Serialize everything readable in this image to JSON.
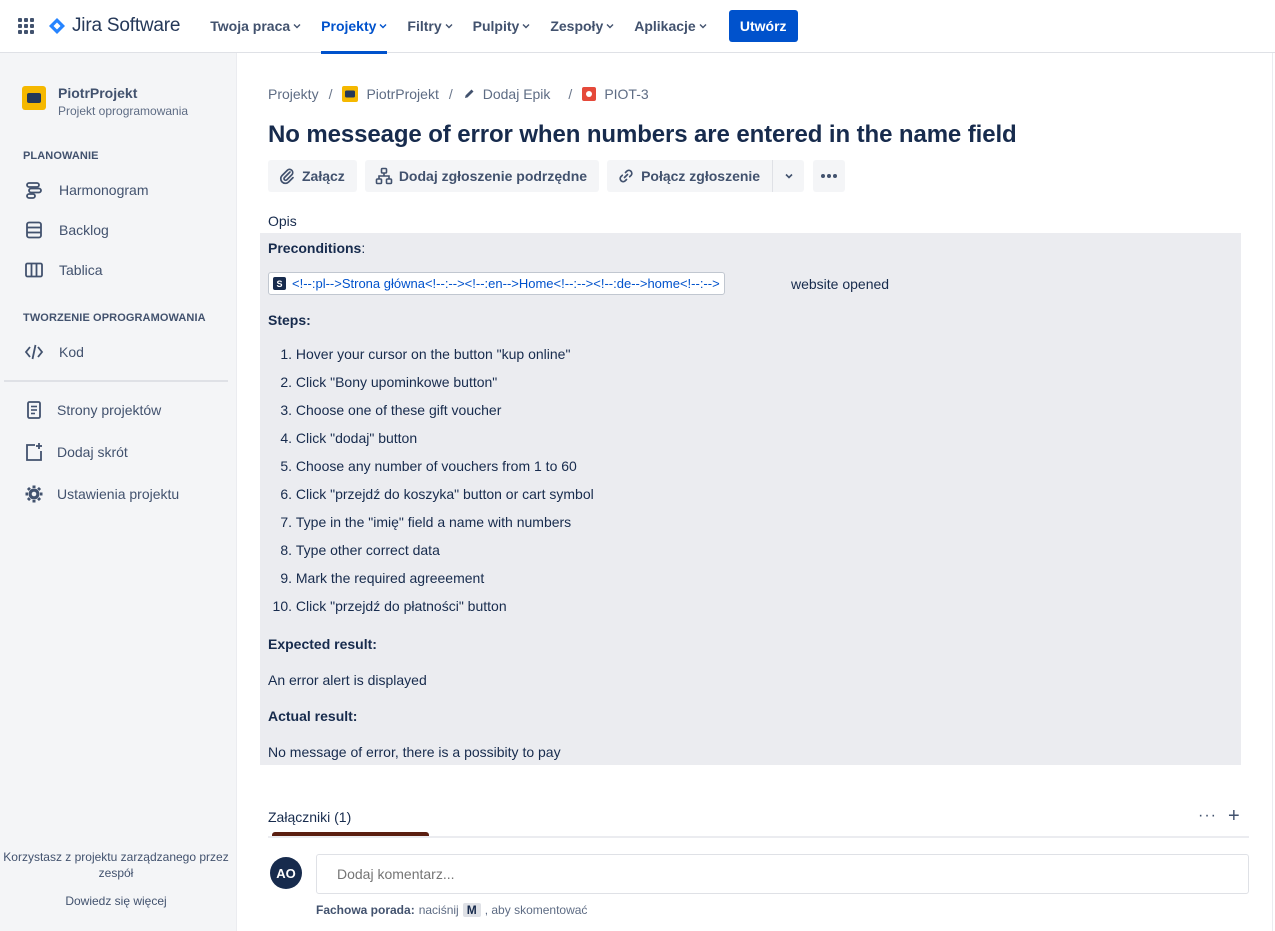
{
  "topnav": {
    "product": "Jira Software",
    "items": [
      {
        "label": "Twoja praca",
        "active": false
      },
      {
        "label": "Projekty",
        "active": true
      },
      {
        "label": "Filtry",
        "active": false
      },
      {
        "label": "Pulpity",
        "active": false
      },
      {
        "label": "Zespoły",
        "active": false
      },
      {
        "label": "Aplikacje",
        "active": false
      }
    ],
    "create_label": "Utwórz"
  },
  "sidebar": {
    "project_name": "PiotrProjekt",
    "project_type": "Projekt oprogramowania",
    "section_planning": "PLANOWANIE",
    "planning_items": [
      {
        "label": "Harmonogram",
        "icon": "roadmap-icon"
      },
      {
        "label": "Backlog",
        "icon": "backlog-icon"
      },
      {
        "label": "Tablica",
        "icon": "board-icon"
      }
    ],
    "section_dev": "TWORZENIE OPROGRAMOWANIA",
    "dev_items": [
      {
        "label": "Kod",
        "icon": "code-icon"
      }
    ],
    "other_items": [
      {
        "label": "Strony projektów",
        "icon": "pages-icon"
      },
      {
        "label": "Dodaj skrót",
        "icon": "add-shortcut-icon"
      },
      {
        "label": "Ustawienia projektu",
        "icon": "settings-icon"
      }
    ],
    "footer_text_1": "Korzystasz z projektu zarządzanego przez",
    "footer_text_2": "zespół",
    "footer_link": "Dowiedz się więcej"
  },
  "breadcrumbs": {
    "projects": "Projekty",
    "project": "PiotrProjekt",
    "epic": "Dodaj Epik",
    "issue": "PIOT-3"
  },
  "issue": {
    "title": "No messeage of error when numbers are entered in the name field",
    "actions": {
      "attach": "Załącz",
      "add_child": "Dodaj zgłoszenie podrzędne",
      "link": "Połącz zgłoszenie"
    },
    "description_label": "Opis",
    "description": {
      "preconditions_label": "Preconditions",
      "preconditions_colon": ":",
      "smartlink_badge": "S",
      "smartlink_text": "<!--:pl-->Strona główna<!--:--><!--:en-->Home<!--:--><!--:de-->home<!--:-->",
      "smartlink_after": "website opened",
      "steps_label": "Steps:",
      "steps": [
        {
          "n": "1.",
          "text": "Hover your cursor on the button \"kup online\""
        },
        {
          "n": "2.",
          "text": "Click \"Bony upominkowe button\""
        },
        {
          "n": "3.",
          "text": "Choose one of these gift voucher"
        },
        {
          "n": "4.",
          "text": "Click \"dodaj\" button"
        },
        {
          "n": "5.",
          "text": "Choose any number of vouchers from 1 to 60"
        },
        {
          "n": "6.",
          "text": "Click \"przejdź do koszyka\" button or cart symbol"
        },
        {
          "n": "7.",
          "text": "Type in the \"imię\" field a name with numbers"
        },
        {
          "n": "8.",
          "text": "Type other correct data"
        },
        {
          "n": "9.",
          "text": "Mark the required agreeement"
        },
        {
          "n": "10.",
          "text": "Click \"przejdź do płatności\" button"
        }
      ],
      "expected_label": "Expected result:",
      "expected_text": "An error alert is displayed",
      "actual_label": "Actual result:",
      "actual_text": "No message of error, there is a possibity to pay"
    },
    "attachments_title": "Załączniki (1)"
  },
  "comment": {
    "avatar_initials": "AO",
    "placeholder": "Dodaj komentarz...",
    "tip_label": "Fachowa porada:",
    "tip_before": "naciśnij",
    "tip_key": "M",
    "tip_after": ", aby skomentować"
  },
  "colors": {
    "brand": "#0052cc",
    "description_bg": "#ebecf0",
    "sidebar_bg": "#f4f5f7",
    "issue_type_bug": "#e5493a",
    "project_avatar": "#f5b800"
  }
}
